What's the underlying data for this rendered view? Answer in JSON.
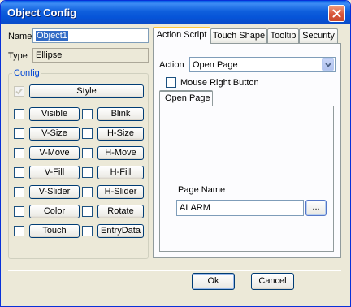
{
  "window": {
    "title": "Object Config"
  },
  "name": {
    "label": "Name",
    "value": "Object1"
  },
  "type": {
    "label": "Type",
    "value": "Ellipse"
  },
  "config": {
    "title": "Config",
    "style_label": "Style",
    "rows": [
      {
        "left": "Visible",
        "right": "Blink"
      },
      {
        "left": "V-Size",
        "right": "H-Size"
      },
      {
        "left": "V-Move",
        "right": "H-Move"
      },
      {
        "left": "V-Fill",
        "right": "H-Fill"
      },
      {
        "left": "V-Slider",
        "right": "H-Slider"
      },
      {
        "left": "Color",
        "right": "Rotate"
      },
      {
        "left": "Touch",
        "right": "EntryData"
      }
    ]
  },
  "tabs": [
    "Action Script",
    "Touch Shape",
    "Tooltip",
    "Security"
  ],
  "action": {
    "label": "Action",
    "selected": "Open Page",
    "right_button_label": "Mouse Right Button",
    "subtab": "Open Page",
    "page_name_label": "Page Name",
    "page_name_value": "ALARM",
    "browse_label": "..."
  },
  "buttons": {
    "ok": "Ok",
    "cancel": "Cancel"
  },
  "colors": {
    "titlebar": "#0654d8",
    "close": "#d8553a",
    "tab_highlight": "#ffc83c",
    "selection": "#316ac5"
  }
}
